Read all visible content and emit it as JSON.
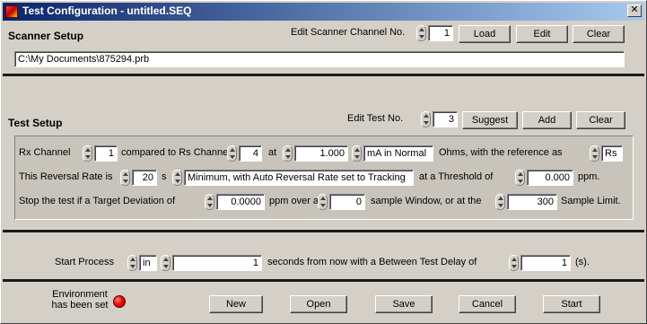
{
  "window": {
    "title": "Test Configuration - untitled.SEQ",
    "close_glyph": "✕",
    "app_icon": "app-icon"
  },
  "scanner": {
    "title": "Scanner Setup",
    "channel_label": "Edit Scanner Channel No.",
    "channel_value": "1",
    "load_label": "Load",
    "edit_label": "Edit",
    "clear_label": "Clear",
    "file_path": "C:\\My Documents\\875294.prb"
  },
  "test_setup": {
    "title": "Test Setup",
    "test_no_label": "Edit Test No.",
    "test_no_value": "3",
    "suggest_label": "Suggest",
    "add_label": "Add",
    "clear_label": "Clear",
    "row1": {
      "rx_label": "Rx Channel",
      "rx_value": "1",
      "compared_label": "compared to Rs Channel",
      "rs_value": "4",
      "at_label": "at",
      "current_value": "1.000",
      "current_mode": "mA in Normal",
      "reference_label": "Ohms, with the reference as",
      "reference_value": "Rs"
    },
    "row2": {
      "reversal_label": "This Reversal Rate is",
      "reversal_value": "20",
      "s_label": "s",
      "reversal_mode": "Minimum, with Auto Reversal Rate set to Tracking",
      "threshold_label": "at a Threshold of",
      "threshold_value": "0.000",
      "ppm_label": "ppm."
    },
    "row3": {
      "stop_label": "Stop the test if a Target Deviation of",
      "deviation_value": "0.0000",
      "ppm_over_label": "ppm over a",
      "window_value": "0",
      "window_label": "sample Window, or at the",
      "limit_value": "300",
      "limit_label": "Sample Limit."
    }
  },
  "process": {
    "start_label": "Start Process",
    "mode_value": "in",
    "seconds_value": "1",
    "seconds_label": "seconds from now with a Between Test Delay of",
    "delay_value": "1",
    "delay_unit": "(s)."
  },
  "footer": {
    "env_line1": "Environment",
    "env_line2": "has been set",
    "env_led_color": "#ff0000",
    "new_label": "New",
    "open_label": "Open",
    "save_label": "Save",
    "cancel_label": "Cancel",
    "start_label": "Start"
  }
}
